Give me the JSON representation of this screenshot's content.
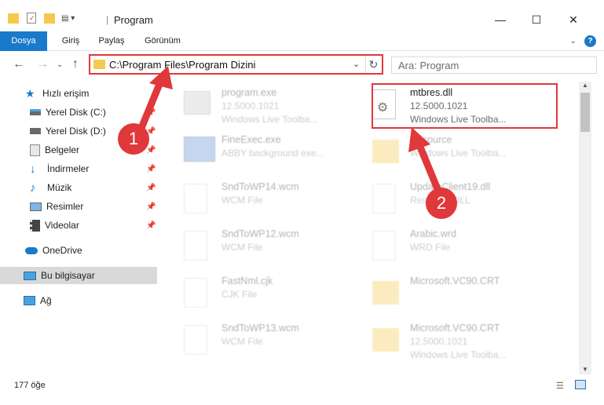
{
  "window": {
    "title": "Program"
  },
  "ribbon": {
    "tabs": [
      "Dosya",
      "Giriş",
      "Paylaş",
      "Görünüm"
    ],
    "help": "?"
  },
  "address": {
    "path": "C:\\Program Files\\Program Dizini"
  },
  "search": {
    "placeholder": "Ara: Program"
  },
  "sidebar": {
    "items": [
      {
        "label": "Hızlı erişim",
        "icon": "star-icon"
      },
      {
        "label": "Yerel Disk (C:)",
        "icon": "drive-icon"
      },
      {
        "label": "Yerel Disk (D:)",
        "icon": "drive-icon"
      },
      {
        "label": "Belgeler",
        "icon": "documents-icon"
      },
      {
        "label": "İndirmeler",
        "icon": "download-icon"
      },
      {
        "label": "Müzik",
        "icon": "music-icon"
      },
      {
        "label": "Resimler",
        "icon": "pictures-icon"
      },
      {
        "label": "Videolar",
        "icon": "video-icon"
      },
      {
        "label": "OneDrive",
        "icon": "cloud-icon"
      },
      {
        "label": "Bu bilgisayar",
        "icon": "computer-icon"
      },
      {
        "label": "Ağ",
        "icon": "network-icon"
      }
    ]
  },
  "files": [
    {
      "name": "program.exe",
      "line2": "12.5000.1021",
      "line3": "Windows Live Toolba..."
    },
    {
      "name": "mtbres.dll",
      "line2": "12.5000.1021",
      "line3": "Windows Live Toolba..."
    },
    {
      "name": "FineExec.exe",
      "line2": "ABBY background exe...",
      "line3": ""
    },
    {
      "name": "Resource",
      "line2": "Windows Live Toolba...",
      "line3": ""
    },
    {
      "name": "SndToWP14.wcm",
      "line2": "WCM File",
      "line3": ""
    },
    {
      "name": "UpdateClient19.dll",
      "line2": "Resource DLL",
      "line3": ""
    },
    {
      "name": "SndToWP12.wcm",
      "line2": "WCM File",
      "line3": ""
    },
    {
      "name": "Arabic.wrd",
      "line2": "WRD File",
      "line3": ""
    },
    {
      "name": "FastNml.cjk",
      "line2": "CJK File",
      "line3": ""
    },
    {
      "name": "Microsoft.VC90.CRT",
      "line2": "",
      "line3": ""
    },
    {
      "name": "SndToWP13.wcm",
      "line2": "WCM File",
      "line3": ""
    },
    {
      "name": "Microsoft.VC90.CRT",
      "line2": "12.5000.1021",
      "line3": "Windows Live Toolba..."
    }
  ],
  "status": {
    "count": "177 öğe"
  },
  "callouts": [
    "1",
    "2"
  ],
  "colors": {
    "accent": "#1979ca",
    "annotation": "#e0383b",
    "folder": "#f5c94c"
  }
}
